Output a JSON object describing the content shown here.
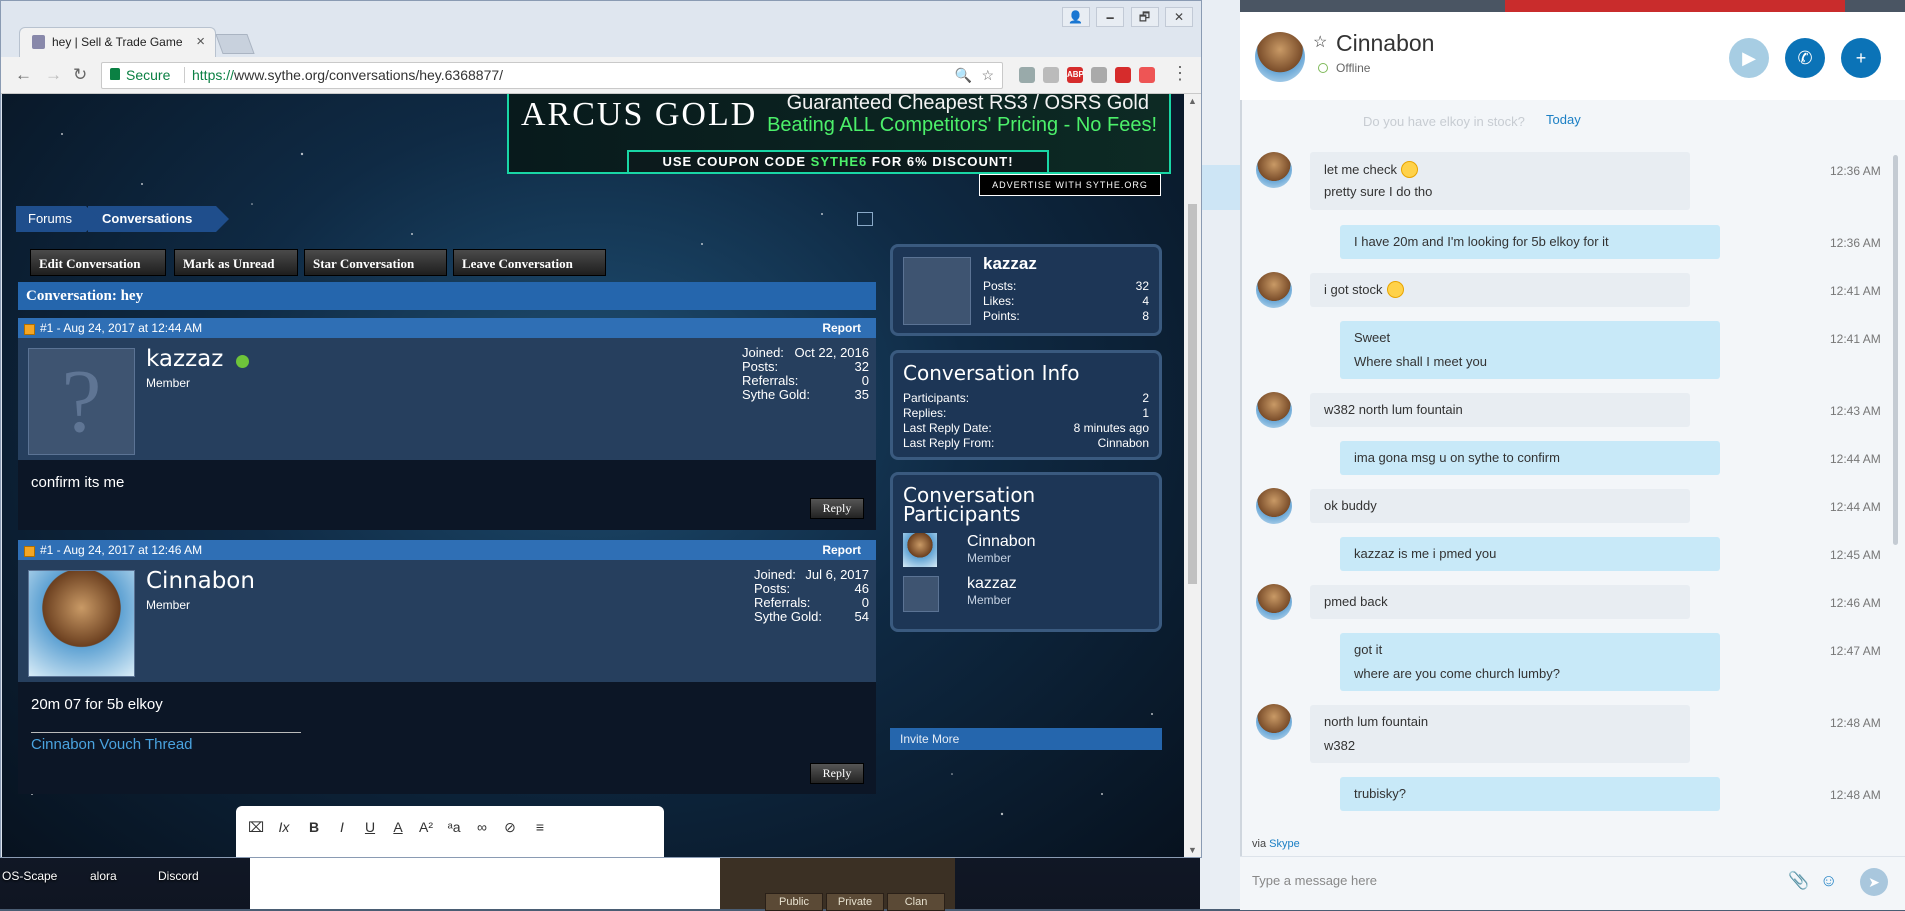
{
  "desktop": {
    "icons": [
      "OS-Scape",
      "alora",
      "Discord"
    ],
    "game_tabs": [
      "Public",
      "Private",
      "Clan"
    ]
  },
  "chrome": {
    "tab_title": "hey | Sell & Trade Game",
    "tab_close": "×",
    "window_controls": [
      "🗕",
      "🗗",
      "✕"
    ],
    "nav": {
      "back": "←",
      "forward": "→",
      "reload": "↻"
    },
    "address": {
      "secure_label": "Secure",
      "url_scheme": "https://",
      "url_rest": "www.sythe.org/conversations/hey.6368877/"
    },
    "extensions": [
      "ABP"
    ],
    "menu": "⋮"
  },
  "ad": {
    "brand": "ARCUS GOLD",
    "line1": "Guaranteed Cheapest RS3 / OSRS Gold",
    "line2": "Beating ALL Competitors' Pricing - No Fees!",
    "coupon_pre": "USE COUPON CODE ",
    "coupon_code": "SYTHE6",
    "coupon_post": " FOR 6% DISCOUNT!",
    "advertise": "ADVERTISE WITH SYTHE.ORG"
  },
  "breadcrumb": [
    "Forums",
    "Conversations"
  ],
  "actions": [
    "Edit Conversation",
    "Mark as Unread",
    "Star Conversation",
    "Leave Conversation"
  ],
  "conversation": {
    "title": "Conversation: hey",
    "messages": [
      {
        "num": "#1 - Aug 24, 2017 at 12:44 AM",
        "report": "Report",
        "user": "kazzaz",
        "rank": "Member",
        "stats": [
          [
            "Joined:",
            "Oct 22, 2016"
          ],
          [
            "Posts:",
            "32"
          ],
          [
            "Referrals:",
            "0"
          ],
          [
            "Sythe Gold:",
            "35"
          ]
        ],
        "body": "confirm its me",
        "reply": "Reply"
      },
      {
        "num": "#1 - Aug 24, 2017 at 12:46 AM",
        "report": "Report",
        "user": "Cinnabon",
        "rank": "Member",
        "stats": [
          [
            "Joined:",
            "Jul 6, 2017"
          ],
          [
            "Posts:",
            "46"
          ],
          [
            "Referrals:",
            "0"
          ],
          [
            "Sythe Gold:",
            "54"
          ]
        ],
        "body": "20m 07 for 5b elkoy",
        "signature_link": "Cinnabon Vouch Thread",
        "reply": "Reply"
      }
    ]
  },
  "sidebar": {
    "profile": {
      "name": "kazzaz",
      "stats": [
        [
          "Posts:",
          "32"
        ],
        [
          "Likes:",
          "4"
        ],
        [
          "Points:",
          "8"
        ]
      ]
    },
    "info": {
      "title": "Conversation Info",
      "rows": [
        [
          "Participants:",
          "2"
        ],
        [
          "Replies:",
          "1"
        ],
        [
          "Last Reply Date:",
          "8 minutes ago"
        ],
        [
          "Last Reply From:",
          "Cinnabon"
        ]
      ]
    },
    "participants": {
      "title_line1": "Conversation",
      "title_line2": "Participants",
      "list": [
        {
          "name": "Cinnabon",
          "rank": "Member"
        },
        {
          "name": "kazzaz",
          "rank": "Member"
        }
      ]
    },
    "invite_more": "Invite More"
  },
  "editor": {
    "icons": [
      "source-icon",
      "clear-format-icon",
      "bold-icon",
      "italic-icon",
      "underline-icon",
      "font-color-icon",
      "font-size-icon",
      "font-family-icon",
      "link-icon",
      "unlink-icon",
      "align-icon"
    ],
    "bold": "B",
    "italic": "I",
    "underline": "U"
  },
  "skype": {
    "contact": "Cinnabon",
    "status": "Offline",
    "today_faded": "Do you have elkoy in stock?",
    "today": "Today",
    "messages": [
      {
        "dir": "in",
        "lines": [
          "let me check",
          "pretty sure I do tho"
        ],
        "emoji_line": 0,
        "time": "12:36 AM"
      },
      {
        "dir": "out",
        "lines": [
          "I have 20m and I'm looking for 5b elkoy for it"
        ],
        "time": "12:36 AM"
      },
      {
        "dir": "in",
        "lines": [
          "i got stock"
        ],
        "emoji_line": 0,
        "time": "12:41 AM"
      },
      {
        "dir": "out",
        "lines": [
          "Sweet",
          "Where shall I meet you"
        ],
        "time": "12:41 AM"
      },
      {
        "dir": "in",
        "lines": [
          "w382 north lum fountain"
        ],
        "time": "12:43 AM"
      },
      {
        "dir": "out",
        "lines": [
          "ima gona msg u on sythe to confirm"
        ],
        "time": "12:44 AM"
      },
      {
        "dir": "in",
        "lines": [
          "ok buddy"
        ],
        "time": "12:44 AM"
      },
      {
        "dir": "out",
        "lines": [
          "kazzaz is me i pmed you"
        ],
        "time": "12:45 AM"
      },
      {
        "dir": "in",
        "lines": [
          "pmed back"
        ],
        "time": "12:46 AM"
      },
      {
        "dir": "out",
        "lines": [
          "got it",
          "where are you come church lumby?"
        ],
        "time": "12:47 AM"
      },
      {
        "dir": "in",
        "lines": [
          "north lum fountain",
          "w382"
        ],
        "time": "12:48 AM"
      },
      {
        "dir": "out",
        "lines": [
          "trubisky?"
        ],
        "time": "12:48 AM"
      }
    ],
    "via_prefix": "via ",
    "via_link": "Skype",
    "compose_placeholder": "Type a message here"
  }
}
